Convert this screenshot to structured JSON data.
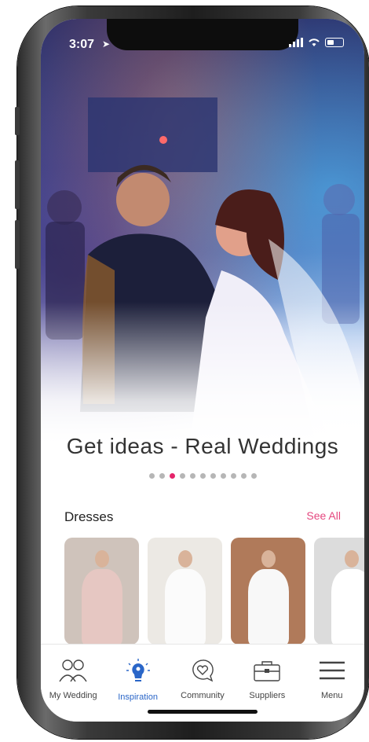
{
  "status_bar": {
    "time": "3:07"
  },
  "hero": {
    "title": "Get ideas - Real Weddings",
    "page_count": 11,
    "active_page": 3
  },
  "section": {
    "title": "Dresses",
    "see_all_label": "See All"
  },
  "cards": [
    {
      "name": "dress-card-runway",
      "bg": "#cfc3bb",
      "gown": "#e6c7c2"
    },
    {
      "name": "dress-card-vneck",
      "bg": "#ece9e4",
      "gown": "#fbfbfb"
    },
    {
      "name": "dress-card-outdoor",
      "bg": "#b07a5a",
      "gown": "#f8f8f8"
    },
    {
      "name": "dress-card-studio",
      "bg": "#dcdcdc",
      "gown": "#ffffff"
    }
  ],
  "tabs": [
    {
      "id": "my-wedding",
      "label": "My Wedding",
      "icon": "couple-icon",
      "active": false
    },
    {
      "id": "inspiration",
      "label": "Inspiration",
      "icon": "lightbulb-icon",
      "active": true
    },
    {
      "id": "community",
      "label": "Community",
      "icon": "heart-chat-icon",
      "active": false
    },
    {
      "id": "suppliers",
      "label": "Suppliers",
      "icon": "briefcase-icon",
      "active": false
    },
    {
      "id": "menu",
      "label": "Menu",
      "icon": "hamburger-icon",
      "active": false
    }
  ],
  "colors": {
    "accent": "#e5246a",
    "active_tab": "#2a66c8"
  }
}
